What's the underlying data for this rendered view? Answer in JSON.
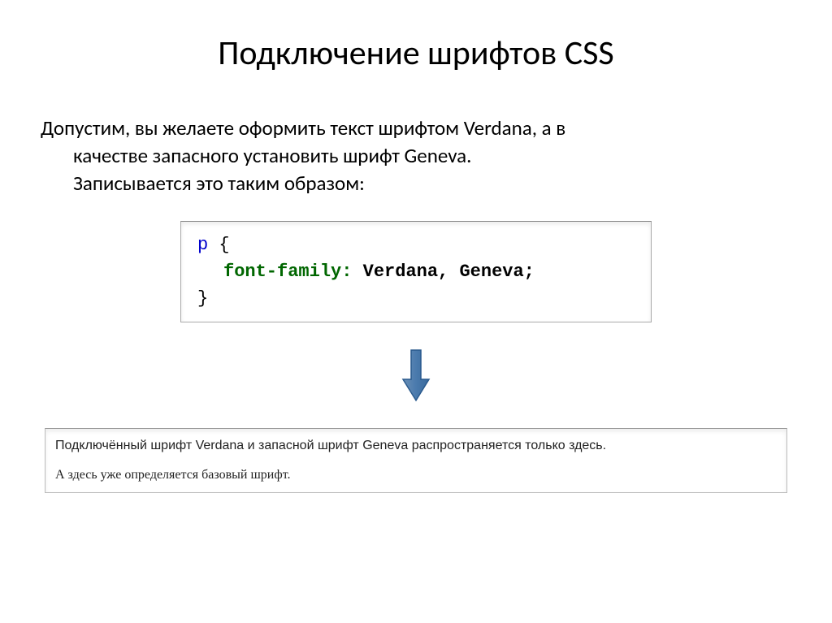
{
  "title": "Подключение шрифтов CSS",
  "paragraph": {
    "line1": "Допустим, вы желаете оформить текст шрифтом Verdana, а в",
    "line2": "качестве запасного установить шрифт Geneva.",
    "line3": "Записывается это таким образом:"
  },
  "code": {
    "selector": "p",
    "brace_open": "{",
    "property": "font-family:",
    "value": " Verdana, Geneva;",
    "brace_close": "}"
  },
  "result": {
    "verdana_text": "Подключённый шрифт Verdana и запасной шрифт Geneva распространяется только здесь.",
    "base_text": "А здесь уже определяется базовый шрифт."
  }
}
